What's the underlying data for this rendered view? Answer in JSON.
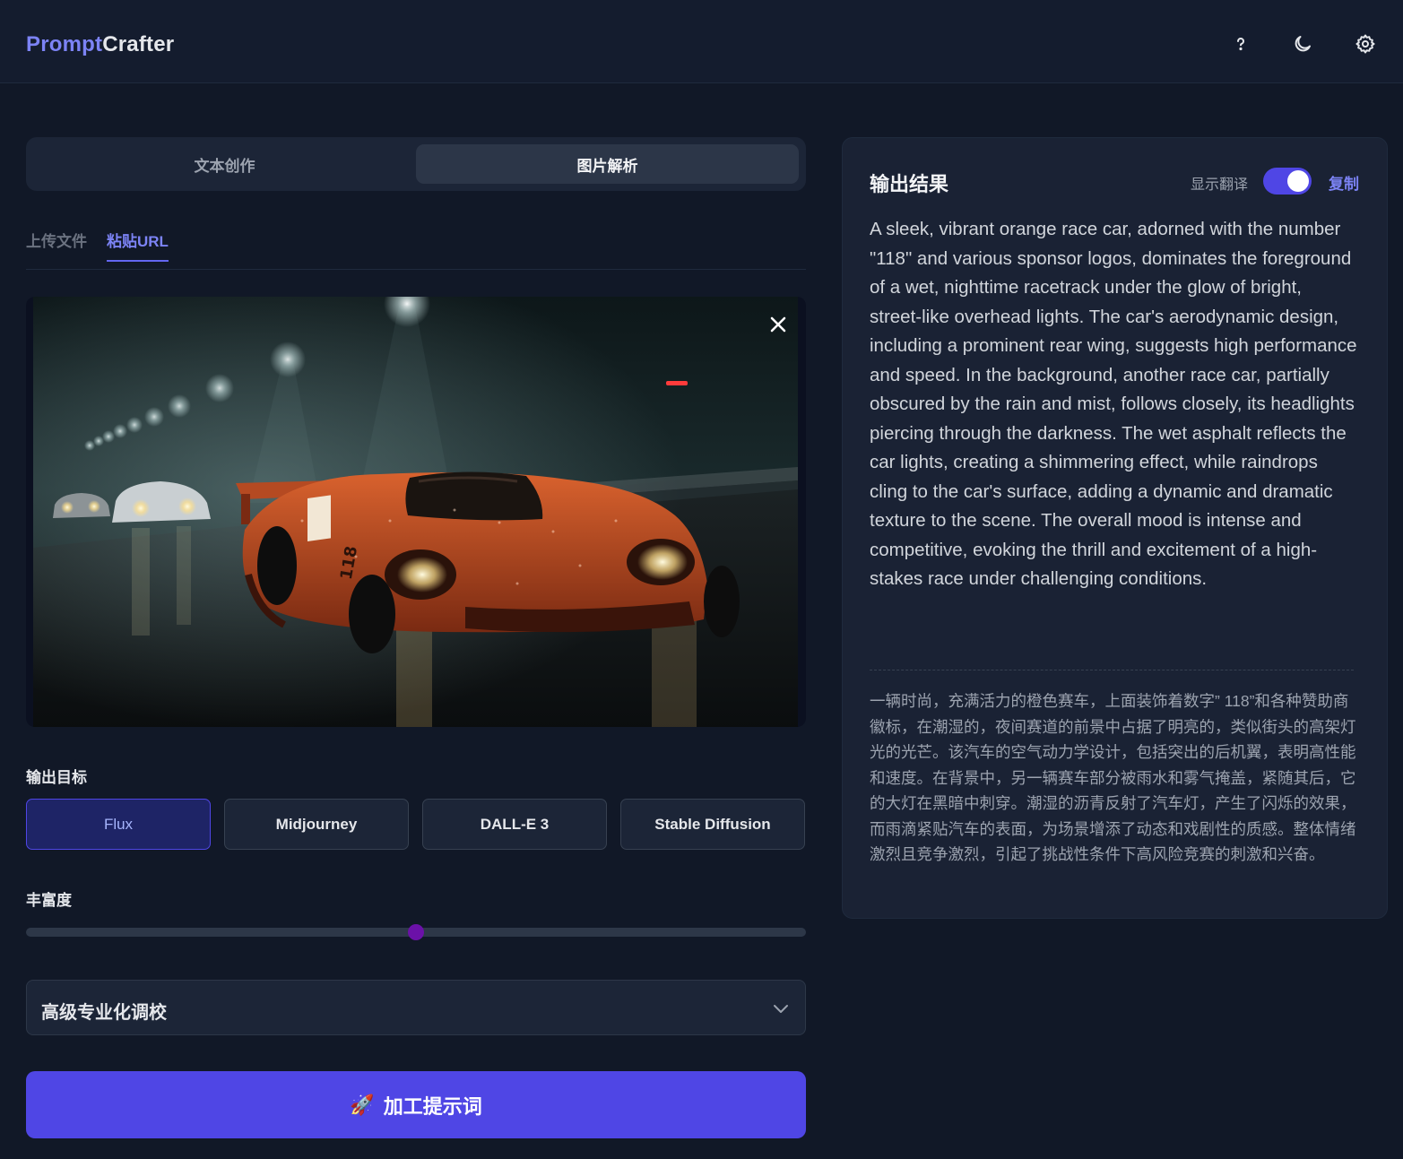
{
  "header": {
    "logo_part1": "Prompt",
    "logo_part2": "Crafter",
    "icons": [
      "help-icon",
      "moon-icon",
      "gear-icon"
    ]
  },
  "mode_tabs": [
    {
      "label": "文本创作",
      "active": false
    },
    {
      "label": "图片解析",
      "active": true
    }
  ],
  "source_tabs": [
    {
      "label": "上传文件",
      "active": false
    },
    {
      "label": "粘贴URL",
      "active": true
    }
  ],
  "image_preview": {
    "subject": "orange race car number 118 on wet night track",
    "close_icon": "close-icon"
  },
  "output_target": {
    "label": "输出目标",
    "options": [
      "Flux",
      "Midjourney",
      "DALL-E 3",
      "Stable Diffusion"
    ],
    "selected": "Flux"
  },
  "richness": {
    "label": "丰富度",
    "value": 0.5
  },
  "advanced": {
    "label": "高级专业化调校",
    "icon": "chevron-down-icon"
  },
  "process_button": {
    "icon": "🚀",
    "label": "加工提示词"
  },
  "result": {
    "title": "输出结果",
    "translate_label": "显示翻译",
    "translate_on": true,
    "copy_label": "复制",
    "text_en": "A sleek, vibrant orange race car, adorned with the number \"118\" and various sponsor logos, dominates the foreground of a wet, nighttime racetrack under the glow of bright, street-like overhead lights. The car's aerodynamic design, including a prominent rear wing, suggests high performance and speed. In the background, another race car, partially obscured by the rain and mist, follows closely, its headlights piercing through the darkness. The wet asphalt reflects the car lights, creating a shimmering effect, while raindrops cling to the car's surface, adding a dynamic and dramatic texture to the scene. The overall mood is intense and competitive, evoking the thrill and excitement of a high-stakes race under challenging conditions.",
    "text_zh": "一辆时尚，充满活力的橙色赛车，上面装饰着数字” 118”和各种赞助商徽标，在潮湿的，夜间赛道的前景中占据了明亮的，类似街头的高架灯光的光芒。该汽车的空气动力学设计，包括突出的后机翼，表明高性能和速度。在背景中，另一辆赛车部分被雨水和雾气掩盖，紧随其后，它的大灯在黑暗中刺穿。潮湿的沥青反射了汽车灯，产生了闪烁的效果，而雨滴紧贴汽车的表面，为场景增添了动态和戏剧性的质感。整体情绪激烈且竞争激烈，引起了挑战性条件下高风险竞赛的刺激和兴奋。"
  },
  "colors": {
    "accent": "#4f46e5",
    "accent_text": "#7c83f5",
    "background": "#111827",
    "panel": "#1a2234",
    "slider_thumb": "#6b11a8"
  }
}
